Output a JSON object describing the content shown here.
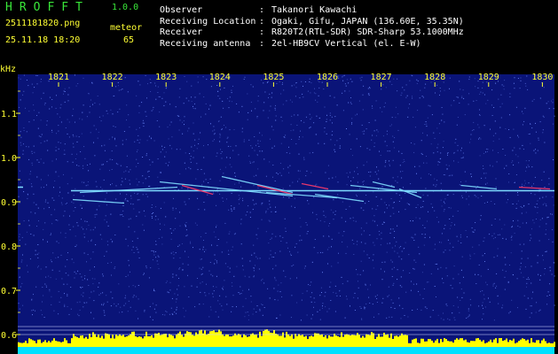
{
  "header": {
    "app_title": "HROFFT",
    "app_version": "1.0.0",
    "file_name": "2511181820.png",
    "date_time": "25.11.18 18:20",
    "meteor_label": "meteor",
    "meteor_count": "65",
    "info": [
      {
        "key": "Observer",
        "value": "Takanori Kawachi"
      },
      {
        "key": "Receiving Location",
        "value": "Ogaki, Gifu, JAPAN (136.60E, 35.35N)"
      },
      {
        "key": "Receiver",
        "value": "R820T2(RTL-SDR) SDR-Sharp 53.1000MHz"
      },
      {
        "key": "Receiving antenna",
        "value": "2el-HB9CV Vertical (el. E-W)"
      }
    ]
  },
  "spectrogram": {
    "unit_label": "kHz",
    "time_labels": [
      "1821",
      "1822",
      "1823",
      "1824",
      "1825",
      "1826",
      "1827",
      "1828",
      "1829",
      "1830"
    ],
    "freq_labels": [
      "1.1",
      "1.0",
      "0.9",
      "0.8",
      "0.7",
      "0.6"
    ],
    "freq_values": [
      1.1,
      1.0,
      0.9,
      0.8,
      0.7,
      0.6
    ],
    "carrier_khz": 0.925,
    "colors": {
      "background": "#0a1478",
      "noise": "#6f8cff",
      "carrier": "#7fdcff",
      "echo_hot": "#ff3b6b",
      "level_bar": "#ffff00",
      "level_base": "#00e0ff",
      "label": "#ffff33",
      "grid": "#cfd6ff"
    }
  }
}
